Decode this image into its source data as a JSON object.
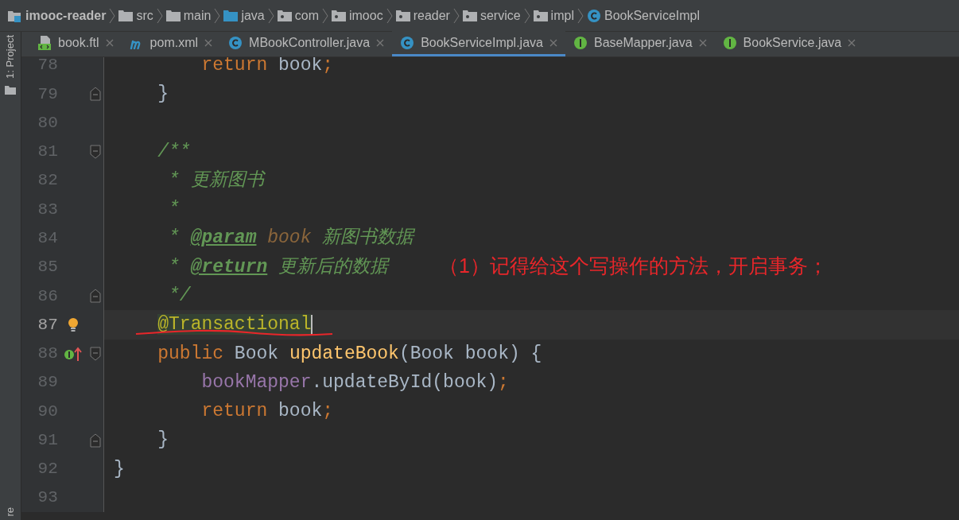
{
  "breadcrumbs": [
    {
      "label": "imooc-reader",
      "kind": "project"
    },
    {
      "label": "src",
      "kind": "folder"
    },
    {
      "label": "main",
      "kind": "folder"
    },
    {
      "label": "java",
      "kind": "source_folder"
    },
    {
      "label": "com",
      "kind": "package"
    },
    {
      "label": "imooc",
      "kind": "package"
    },
    {
      "label": "reader",
      "kind": "package"
    },
    {
      "label": "service",
      "kind": "package"
    },
    {
      "label": "impl",
      "kind": "package"
    },
    {
      "label": "BookServiceImpl",
      "kind": "class"
    }
  ],
  "sidebar": {
    "top_label": "1: Project",
    "bottom_label": "re"
  },
  "tabs": [
    {
      "label": "book.ftl",
      "kind": "template",
      "selected": false
    },
    {
      "label": "pom.xml",
      "kind": "maven",
      "selected": false
    },
    {
      "label": "MBookController.java",
      "kind": "class",
      "selected": false
    },
    {
      "label": "BookServiceImpl.java",
      "kind": "class",
      "selected": true
    },
    {
      "label": "BaseMapper.java",
      "kind": "interface",
      "selected": false
    },
    {
      "label": "BookService.java",
      "kind": "interface",
      "selected": false
    }
  ],
  "lines": [
    {
      "number": "78",
      "current": false,
      "tokens": [
        {
          "text": "        return",
          "kind": "keyword"
        },
        {
          "text": " book",
          "kind": "plain"
        },
        {
          "text": ";",
          "kind": "keyword"
        }
      ]
    },
    {
      "number": "79",
      "current": false,
      "fold": {
        "kind": "end"
      },
      "tokens": [
        {
          "text": "    }",
          "kind": "plain"
        }
      ]
    },
    {
      "number": "80",
      "current": false
    },
    {
      "number": "81",
      "current": false,
      "fold": {
        "kind": "start"
      },
      "tokens": [
        {
          "text": "    /**",
          "kind": "doc"
        }
      ]
    },
    {
      "number": "82",
      "current": false,
      "tokens": [
        {
          "text": "     * 更新图书",
          "kind": "doc"
        }
      ]
    },
    {
      "number": "83",
      "current": false,
      "tokens": [
        {
          "text": "     *",
          "kind": "doc"
        }
      ]
    },
    {
      "number": "84",
      "current": false,
      "tokens": [
        {
          "text": "     * ",
          "kind": "doc"
        },
        {
          "text": "@param",
          "kind": "doc_tag"
        },
        {
          "text": " book",
          "kind": "doc_param"
        },
        {
          "text": " 新图书数据",
          "kind": "doc"
        }
      ]
    },
    {
      "number": "85",
      "current": false,
      "tokens": [
        {
          "text": "     * ",
          "kind": "doc"
        },
        {
          "text": "@return",
          "kind": "doc_tag"
        },
        {
          "text": " 更新后的数据",
          "kind": "doc"
        }
      ]
    },
    {
      "number": "86",
      "current": false,
      "fold": {
        "kind": "end"
      },
      "tokens": [
        {
          "text": "     */",
          "kind": "doc"
        }
      ]
    },
    {
      "number": "87",
      "current": true,
      "gutter": {
        "kind": "bulb"
      },
      "tokens": [
        {
          "text": "    @Transactional",
          "kind": "annotation",
          "highlighted": true
        }
      ]
    },
    {
      "number": "88",
      "current": false,
      "gutter": {
        "kind": "implements"
      },
      "fold": {
        "kind": "start"
      },
      "tokens": [
        {
          "text": "    public",
          "kind": "keyword"
        },
        {
          "text": " Book ",
          "kind": "plain"
        },
        {
          "text": "updateBook",
          "kind": "method"
        },
        {
          "text": "(Book book) {",
          "kind": "plain"
        }
      ]
    },
    {
      "number": "89",
      "current": false,
      "tokens": [
        {
          "text": "        bookMapper",
          "kind": "field"
        },
        {
          "text": ".updateById(book)",
          "kind": "plain"
        },
        {
          "text": ";",
          "kind": "keyword"
        }
      ]
    },
    {
      "number": "90",
      "current": false,
      "tokens": [
        {
          "text": "        return",
          "kind": "keyword"
        },
        {
          "text": " book",
          "kind": "plain"
        },
        {
          "text": ";",
          "kind": "keyword"
        }
      ]
    },
    {
      "number": "91",
      "current": false,
      "fold": {
        "kind": "end"
      },
      "tokens": [
        {
          "text": "    }",
          "kind": "plain"
        }
      ]
    },
    {
      "number": "92",
      "current": false,
      "tokens": [
        {
          "text": "}",
          "kind": "plain"
        }
      ]
    },
    {
      "number": "93",
      "current": false
    }
  ],
  "annotation": {
    "text": "（1）记得给这个写操作的方法，开启事务；"
  }
}
